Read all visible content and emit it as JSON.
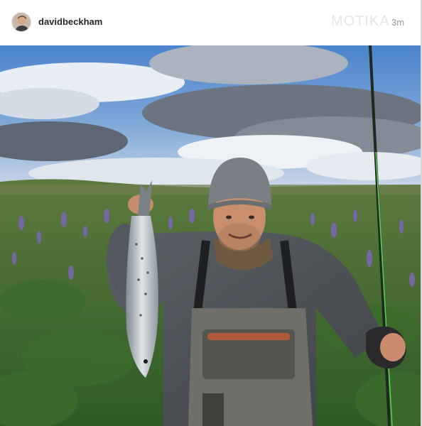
{
  "post": {
    "username": "davidbeckham",
    "timestamp": "3m",
    "watermark": "MOTIKA"
  },
  "icons": {
    "avatar": "user-avatar-photo"
  },
  "colors": {
    "username_text": "#262626",
    "timestamp_text": "#9a9a9a"
  }
}
